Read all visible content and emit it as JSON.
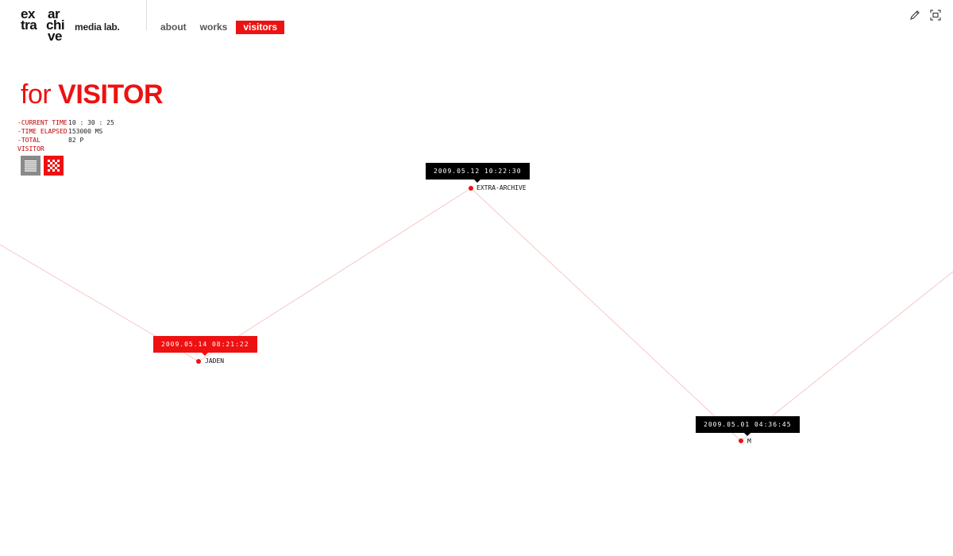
{
  "logo": {
    "w1": "ex",
    "w2": "ar",
    "w3": "tra",
    "w4": "chi",
    "w5": "ve",
    "tagline": "media lab."
  },
  "nav": {
    "items": [
      {
        "label": "about"
      },
      {
        "label": "works"
      },
      {
        "label": "visitors"
      }
    ],
    "active": "visitors"
  },
  "tools": [
    "pencil-icon",
    "expand-icon"
  ],
  "title": {
    "prefix": "for",
    "main": "VISITOR"
  },
  "stats": [
    {
      "label": "-CURRENT TIME",
      "value": "10 : 30 : 25"
    },
    {
      "label": "-TIME ELAPSED",
      "value": "153000 MS"
    },
    {
      "label": "-TOTAL VISITOR",
      "value": "82 P"
    }
  ],
  "view_toggles": [
    "list-view-icon",
    "grid-view-icon"
  ],
  "visitors": [
    {
      "timestamp": "2009.05.14  08:21:22",
      "name": "JADEN",
      "highlight": true
    },
    {
      "timestamp": "2009.05.12  10:22:30",
      "name": "EXTRA-ARCHIVE",
      "highlight": false
    },
    {
      "timestamp": "2009.05.01  04:36:45",
      "name": "M",
      "highlight": false
    }
  ],
  "colors": {
    "accent": "#ee1111",
    "line": "#f7c8c8",
    "tooltip_dark": "#000000"
  }
}
